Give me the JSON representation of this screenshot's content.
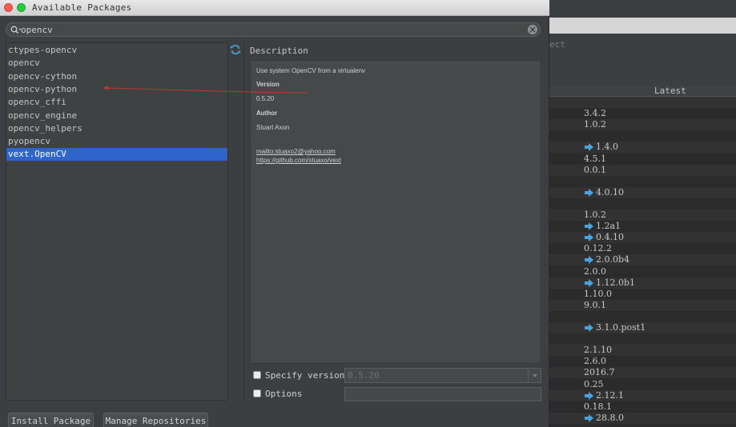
{
  "window": {
    "title": "Available Packages"
  },
  "background": {
    "hint_text": "ect",
    "column_header": "Latest",
    "rows": [
      {
        "version": "",
        "arrow": false
      },
      {
        "version": "3.4.2",
        "arrow": false
      },
      {
        "version": "1.0.2",
        "arrow": false
      },
      {
        "version": "",
        "arrow": false
      },
      {
        "version": "1.4.0",
        "arrow": true
      },
      {
        "version": "4.5.1",
        "arrow": false
      },
      {
        "version": "0.0.1",
        "arrow": false
      },
      {
        "version": "",
        "arrow": false
      },
      {
        "version": "4.0.10",
        "arrow": true
      },
      {
        "version": "",
        "arrow": false
      },
      {
        "version": "1.0.2",
        "arrow": false
      },
      {
        "version": "1.2a1",
        "arrow": true
      },
      {
        "version": "0.4.10",
        "arrow": true
      },
      {
        "version": "0.12.2",
        "arrow": false
      },
      {
        "version": "2.0.0b4",
        "arrow": true
      },
      {
        "version": "2.0.0",
        "arrow": false
      },
      {
        "version": "1.12.0b1",
        "arrow": true
      },
      {
        "version": "1.10.0",
        "arrow": false
      },
      {
        "version": "9.0.1",
        "arrow": false
      },
      {
        "version": "",
        "arrow": false
      },
      {
        "version": "3.1.0.post1",
        "arrow": true
      },
      {
        "version": "",
        "arrow": false
      },
      {
        "version": "2.1.10",
        "arrow": false
      },
      {
        "version": "2.6.0",
        "arrow": false
      },
      {
        "version": "2016.7",
        "arrow": false
      },
      {
        "version": "0.25",
        "arrow": false
      },
      {
        "version": "2.12.1",
        "arrow": true
      },
      {
        "version": "0.18.1",
        "arrow": false
      },
      {
        "version": "28.8.0",
        "arrow": true
      }
    ]
  },
  "search": {
    "value": "opencv",
    "icon": "search-icon"
  },
  "packages": [
    {
      "name": "ctypes-opencv",
      "selected": false
    },
    {
      "name": "opencv",
      "selected": false
    },
    {
      "name": "opencv-cython",
      "selected": false
    },
    {
      "name": "opencv-python",
      "selected": false
    },
    {
      "name": "opencv_cffi",
      "selected": false
    },
    {
      "name": "opencv_engine",
      "selected": false
    },
    {
      "name": "opencv_helpers",
      "selected": false
    },
    {
      "name": "pyopencv",
      "selected": false
    },
    {
      "name": "vext.OpenCV",
      "selected": true
    }
  ],
  "description": {
    "label": "Description",
    "summary": "Use system OpenCV from a virtualenv",
    "version_label": "Version",
    "version": "0.5.20",
    "author_label": "Author",
    "author": "Stuart Axon",
    "email_link": "mailto:stuaxo2@yahoo.com",
    "url_link": "https://github.com/stuaxo/vext"
  },
  "options": {
    "specify_version_label": "Specify version",
    "specify_version_value": "0.5.20",
    "options_label": "Options"
  },
  "buttons": {
    "install": "Install Package",
    "manage": "Manage Repositories"
  },
  "colors": {
    "selection": "#2f65ca",
    "link": "#589df6",
    "accent_arrow": "#4aa3df",
    "annotation": "#c0392b"
  }
}
